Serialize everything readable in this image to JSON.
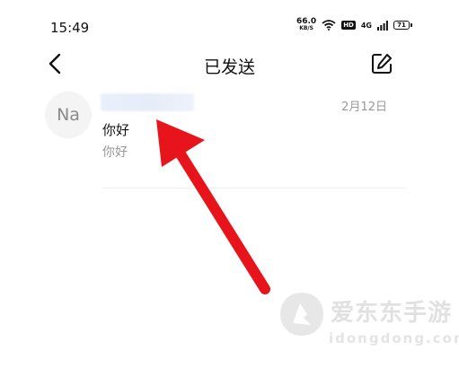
{
  "status_bar": {
    "time": "15:49",
    "net_speed_value": "66.0",
    "net_speed_unit": "KB/S",
    "hd_label": "HD",
    "network_type": "4G",
    "battery_level": "71"
  },
  "header": {
    "title": "已发送",
    "back_icon": "chevron-left-icon",
    "compose_icon": "edit-icon"
  },
  "messages": [
    {
      "avatar_text": "Na",
      "date": "2月12日",
      "subject": "你好",
      "preview": "你好"
    }
  ],
  "watermark": {
    "brand": "爱东东手游",
    "url": "idongdong.com"
  },
  "annotation": {
    "arrow_color": "#e8141b"
  }
}
